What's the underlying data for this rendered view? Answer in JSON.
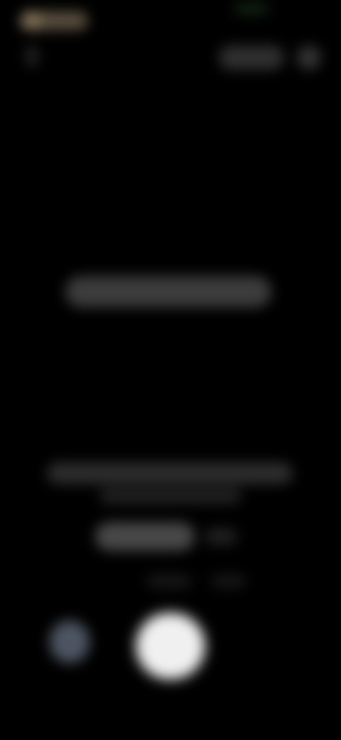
{
  "theme": {
    "background": "#000000",
    "accent": "#f0f0f0",
    "secondary": "#5a6473"
  },
  "status_bar": {
    "time": "",
    "indicator": ""
  },
  "header": {
    "back_icon": "back-icon",
    "action_label": "",
    "action_icon": "more-icon"
  },
  "center": {
    "message": ""
  },
  "bottom": {
    "line_1": "",
    "line_2": "",
    "primary_label": "",
    "secondary_label": "",
    "hint_1": "",
    "hint_2": ""
  },
  "controls": {
    "left_icon": "gallery-icon",
    "main_icon": "shutter-icon"
  }
}
